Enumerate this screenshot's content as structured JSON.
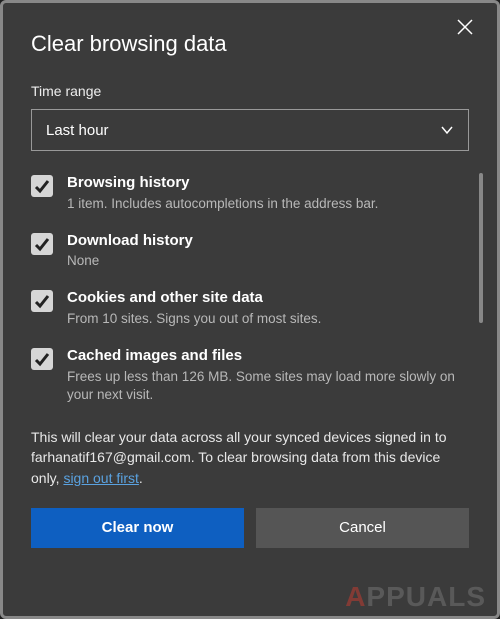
{
  "dialog": {
    "title": "Clear browsing data",
    "time_range_label": "Time range",
    "time_range_value": "Last hour",
    "options": [
      {
        "checked": true,
        "title": "Browsing history",
        "desc": "1 item. Includes autocompletions in the address bar."
      },
      {
        "checked": true,
        "title": "Download history",
        "desc": "None"
      },
      {
        "checked": true,
        "title": "Cookies and other site data",
        "desc": "From 10 sites. Signs you out of most sites."
      },
      {
        "checked": true,
        "title": "Cached images and files",
        "desc": "Frees up less than 126 MB. Some sites may load more slowly on your next visit."
      }
    ],
    "note_prefix": "This will clear your data across all your synced devices signed in to ",
    "note_email": "farhanatif167@gmail.com",
    "note_mid": ". To clear browsing data from this device only, ",
    "note_link": "sign out first",
    "note_suffix": ".",
    "primary_btn": "Clear now",
    "secondary_btn": "Cancel"
  },
  "watermark": "PPUALS"
}
